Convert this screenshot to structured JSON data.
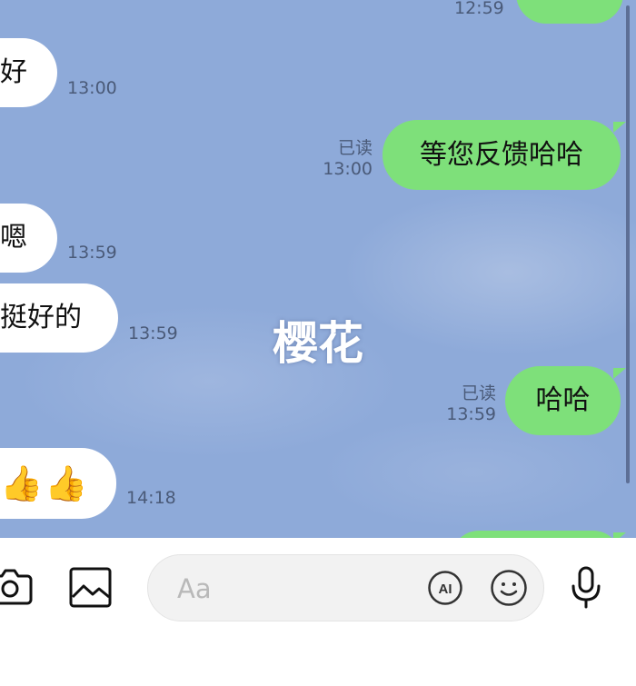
{
  "chat": {
    "wallpaper_label": "樱花",
    "messages": [
      {
        "dir": "out",
        "text": "",
        "time": "12:59"
      },
      {
        "dir": "in",
        "text": "好",
        "time": "13:00"
      },
      {
        "dir": "out",
        "text": "等您反馈哈哈",
        "read": "已读",
        "time": "13:00"
      },
      {
        "dir": "in",
        "text": "嗯",
        "time": "13:59"
      },
      {
        "dir": "in",
        "text": "挺好的",
        "time": "13:59"
      },
      {
        "dir": "out",
        "text": "哈哈",
        "read": "已读",
        "time": "13:59"
      },
      {
        "dir": "in",
        "text": "👍👍",
        "time": "14:18"
      }
    ]
  },
  "composer": {
    "placeholder": "Aa",
    "ai_label": "AI"
  },
  "colors": {
    "background": "#8eaad9",
    "outgoing_bubble": "#7ee07a",
    "incoming_bubble": "#ffffff"
  }
}
